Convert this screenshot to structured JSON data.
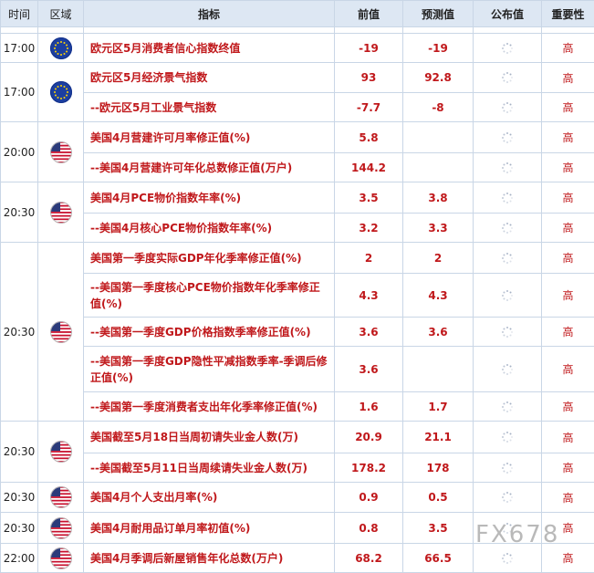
{
  "header": {
    "time": "时间",
    "region": "区域",
    "indicator": "指标",
    "previous": "前值",
    "forecast": "预测值",
    "actual": "公布值",
    "importance": "重要性"
  },
  "colors": {
    "accent_red": "#c0181b",
    "header_bg": "#dde7f3",
    "border": "#c9d6e6"
  },
  "groups": [
    {
      "time": "17:00",
      "region": "eu-flag-icon",
      "rows": [
        {
          "name": "欧元区5月消费者信心指数终值",
          "previous": "-19",
          "forecast": "-19",
          "importance": "高"
        }
      ]
    },
    {
      "time": "17:00",
      "region": "eu-flag-icon",
      "rows": [
        {
          "name": "欧元区5月经济景气指数",
          "previous": "93",
          "forecast": "92.8",
          "importance": "高"
        },
        {
          "name": "--欧元区5月工业景气指数",
          "previous": "-7.7",
          "forecast": "-8",
          "importance": "高"
        }
      ]
    },
    {
      "time": "20:00",
      "region": "us-flag-icon",
      "rows": [
        {
          "name": "美国4月营建许可月率修正值(%)",
          "previous": "5.8",
          "forecast": "",
          "importance": "高"
        },
        {
          "name": "--美国4月营建许可年化总数修正值(万户)",
          "previous": "144.2",
          "forecast": "",
          "importance": "高"
        }
      ]
    },
    {
      "time": "20:30",
      "region": "us-flag-icon",
      "rows": [
        {
          "name": "美国4月PCE物价指数年率(%)",
          "previous": "3.5",
          "forecast": "3.8",
          "importance": "高"
        },
        {
          "name": "--美国4月核心PCE物价指数年率(%)",
          "previous": "3.2",
          "forecast": "3.3",
          "importance": "高"
        }
      ]
    },
    {
      "time": "20:30",
      "region": "us-flag-icon",
      "rows": [
        {
          "name": "美国第一季度实际GDP年化季率修正值(%)",
          "previous": "2",
          "forecast": "2",
          "importance": "高"
        },
        {
          "name": "--美国第一季度核心PCE物价指数年化季率修正值(%)",
          "previous": "4.3",
          "forecast": "4.3",
          "importance": "高"
        },
        {
          "name": "--美国第一季度GDP价格指数季率修正值(%)",
          "previous": "3.6",
          "forecast": "3.6",
          "importance": "高"
        },
        {
          "name": "--美国第一季度GDP隐性平减指数季率-季调后修正值(%)",
          "previous": "3.6",
          "forecast": "",
          "importance": "高"
        },
        {
          "name": "--美国第一季度消费者支出年化季率修正值(%)",
          "previous": "1.6",
          "forecast": "1.7",
          "importance": "高"
        }
      ]
    },
    {
      "time": "20:30",
      "region": "us-flag-icon",
      "rows": [
        {
          "name": "美国截至5月18日当周初请失业金人数(万)",
          "previous": "20.9",
          "forecast": "21.1",
          "importance": "高"
        },
        {
          "name": "--美国截至5月11日当周续请失业金人数(万)",
          "previous": "178.2",
          "forecast": "178",
          "importance": "高"
        }
      ]
    },
    {
      "time": "20:30",
      "region": "us-flag-icon",
      "rows": [
        {
          "name": "美国4月个人支出月率(%)",
          "previous": "0.9",
          "forecast": "0.5",
          "importance": "高"
        }
      ]
    },
    {
      "time": "20:30",
      "region": "us-flag-icon",
      "rows": [
        {
          "name": "美国4月耐用品订单月率初值(%)",
          "previous": "0.8",
          "forecast": "3.5",
          "importance": "高"
        }
      ]
    },
    {
      "time": "22:00",
      "region": "us-flag-icon",
      "rows": [
        {
          "name": "美国4月季调后新屋销售年化总数(万户)",
          "previous": "68.2",
          "forecast": "66.5",
          "importance": "高"
        }
      ]
    }
  ],
  "watermark": "FX678"
}
